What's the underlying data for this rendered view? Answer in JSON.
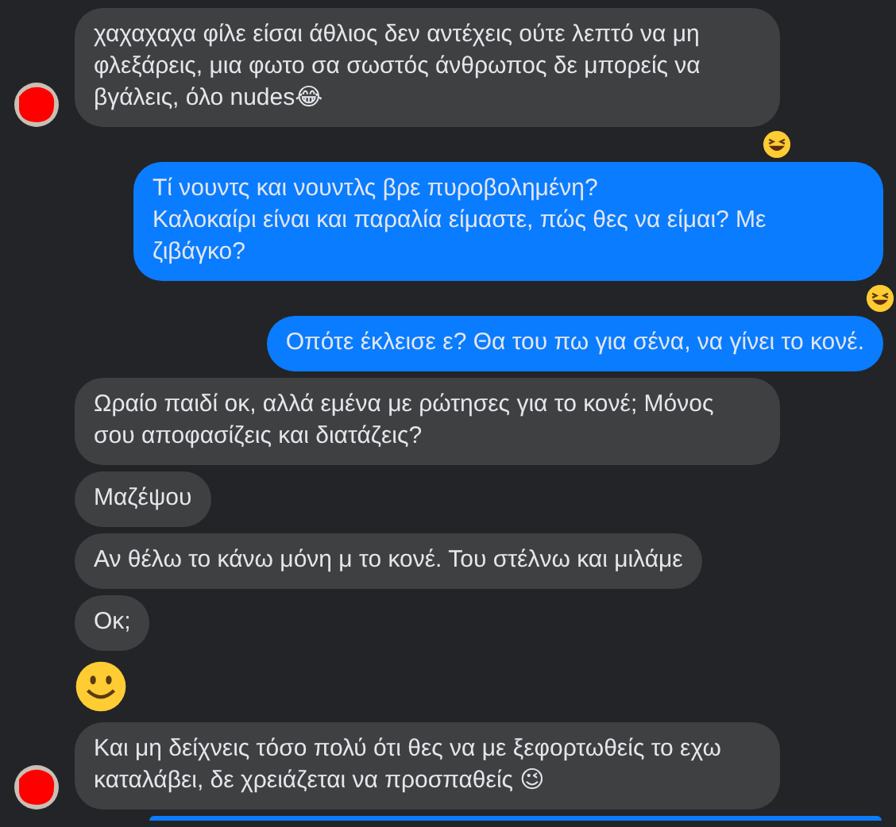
{
  "messages": [
    {
      "sent": false,
      "kind": "text",
      "avatar": true,
      "text": "χαχαχαχα φίλε είσαι άθλιος δεν αντέχεις ούτε λεπτό να μη φλεξάρεις, μια φωτο σα σωστός άνθρωπος δε μπορείς να βγάλεις, όλο nudes😂",
      "reaction": {
        "kind": "laughing"
      }
    },
    {
      "sent": true,
      "kind": "text",
      "text": "Τί νουντς και νουντλς βρε πυροβολημένη?\nΚαλοκαίρι είναι και παραλία είμαστε, πώς θες να είμαι? Με ζιβάγκο?",
      "reaction": {
        "kind": "laughing"
      }
    },
    {
      "sent": true,
      "kind": "text",
      "text": "Οπότε έκλεισε ε? Θα του πω για σένα, να γίνει το κονέ."
    },
    {
      "sent": false,
      "kind": "text",
      "avatar": false,
      "text": "Ωραίο παιδί οκ, αλλά εμένα με ρώτησες για το κονέ; Μόνος σου αποφασίζεις και διατάζεις?"
    },
    {
      "sent": false,
      "kind": "text",
      "avatar": false,
      "text": "Μαζέψου"
    },
    {
      "sent": false,
      "kind": "text",
      "avatar": false,
      "text": "Αν θέλω το κάνω μόνη μ το κονέ. Του στέλνω και μιλάμε"
    },
    {
      "sent": false,
      "kind": "text",
      "avatar": false,
      "text": "Οκ;"
    },
    {
      "sent": false,
      "kind": "emoji",
      "avatar": false,
      "emoji": {
        "kind": "smile"
      }
    },
    {
      "sent": false,
      "kind": "text",
      "avatar": true,
      "text": "Και μη δείχνεις τόσο πολύ ότι θες να με ξεφορτωθείς το εχω καταλάβει, δε χρειάζεται να προσπαθείς 😉"
    },
    {
      "sent": true,
      "kind": "partial"
    }
  ]
}
